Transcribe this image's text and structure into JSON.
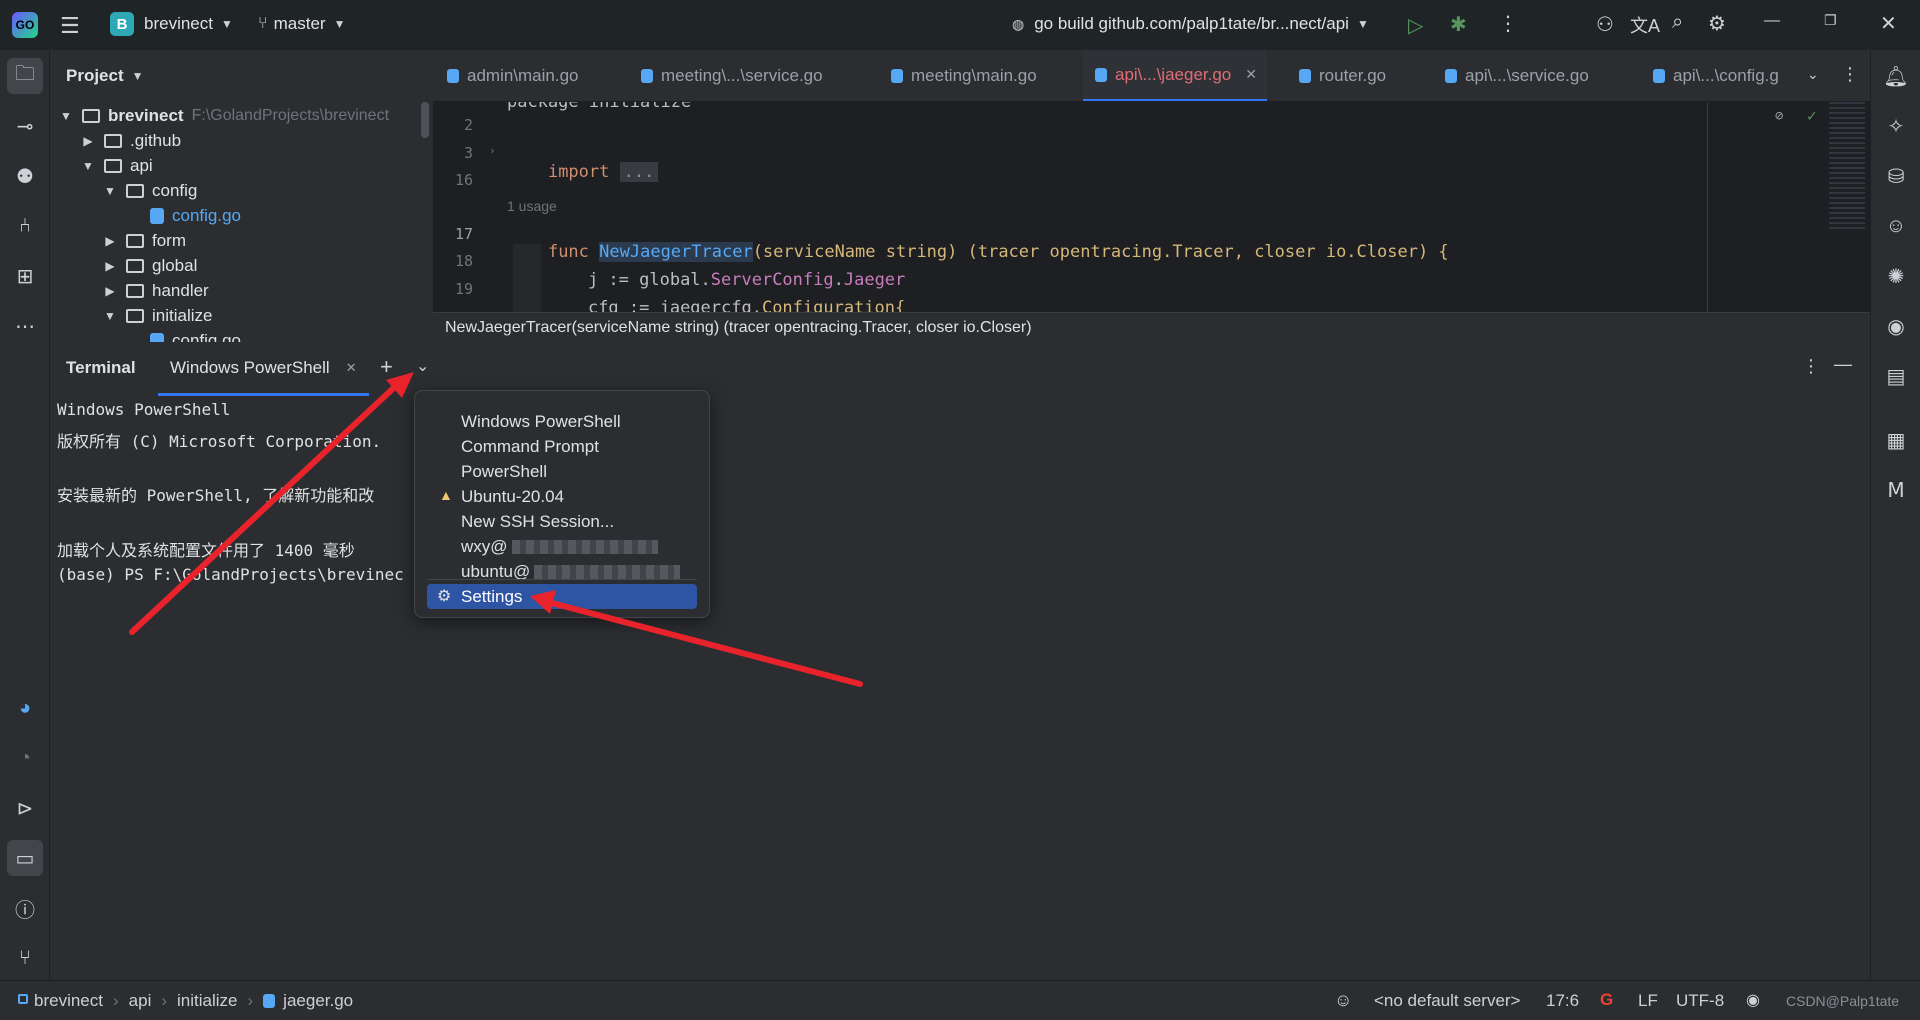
{
  "titlebar": {
    "project_initial": "B",
    "project_name": "brevinect",
    "branch": "master",
    "run_config": "go build github.com/palp1tate/br...nect/api"
  },
  "project_pane": {
    "title": "Project",
    "tree": [
      {
        "label": "brevinect",
        "path": "F:\\GolandProjects\\brevinect",
        "kind": "folder",
        "expanded": true
      },
      {
        "label": ".github",
        "kind": "folder",
        "expanded": false
      },
      {
        "label": "api",
        "kind": "folder",
        "expanded": true
      },
      {
        "label": "config",
        "kind": "folder",
        "expanded": true
      },
      {
        "label": "config.go",
        "kind": "gofile"
      },
      {
        "label": "form",
        "kind": "folder",
        "expanded": false
      },
      {
        "label": "global",
        "kind": "folder",
        "expanded": false
      },
      {
        "label": "handler",
        "kind": "folder",
        "expanded": false
      },
      {
        "label": "initialize",
        "kind": "folder",
        "expanded": true
      },
      {
        "label": "config.go",
        "kind": "gofile"
      }
    ]
  },
  "tabs": [
    {
      "label": "admin\\main.go"
    },
    {
      "label": "meeting\\...\\service.go"
    },
    {
      "label": "meeting\\main.go"
    },
    {
      "label": "api\\...\\jaeger.go",
      "active": true
    },
    {
      "label": "router.go"
    },
    {
      "label": "api\\...\\service.go"
    },
    {
      "label": "api\\...\\config.g"
    }
  ],
  "editor": {
    "line_numbers": [
      "2",
      "3",
      "16",
      "17",
      "18",
      "19"
    ],
    "package_line": "package initialize",
    "import_kw": "import",
    "import_fold": "...",
    "usage_hint": "1 usage",
    "func_kw": "func",
    "func_name": "NewJaegerTracer",
    "func_params": "(serviceName string) (tracer opentracing.Tracer, closer io.Closer) {",
    "line18_a": "j := global.",
    "line18_b": "ServerConfig",
    "line18_c": ".",
    "line18_d": "Jaeger",
    "line19_a": "cfg := jaegercfg.",
    "line19_b": "Configuration",
    "line19_c": "{",
    "signature": "NewJaegerTracer(serviceName string) (tracer opentracing.Tracer, closer io.Closer)"
  },
  "terminal": {
    "title": "Terminal",
    "tab_label": "Windows PowerShell",
    "lines": [
      "Windows PowerShell",
      "版权所有 (C) Microsoft Corporation.",
      "",
      "安装最新的 PowerShell, 了解新功能和改",
      "",
      "加载个人及系统配置文件用了 1400 毫秒",
      "(base) PS F:\\GolandProjects\\brevinec"
    ]
  },
  "dropdown": {
    "items": [
      {
        "label": "Windows PowerShell"
      },
      {
        "label": "Command Prompt"
      },
      {
        "label": "PowerShell"
      },
      {
        "label": "Ubuntu-20.04",
        "icon": "linux-penguin-icon"
      },
      {
        "label": "New SSH Session..."
      },
      {
        "label": "wxy@",
        "redacted": true
      },
      {
        "label": "ubuntu@",
        "redacted": true
      }
    ],
    "settings_label": "Settings"
  },
  "statusbar": {
    "breadcrumb": [
      "brevinect",
      "api",
      "initialize",
      "jaeger.go"
    ],
    "server": "<no default server>",
    "position": "17:6",
    "line_sep": "LF",
    "encoding": "UTF-8",
    "watermark": "CSDN@Palp1tate"
  },
  "colors": {
    "accent": "#3574f0",
    "selection": "#2e55a3",
    "annotation_arrow": "#e8232b",
    "active_tab_text": "#e06c75"
  }
}
